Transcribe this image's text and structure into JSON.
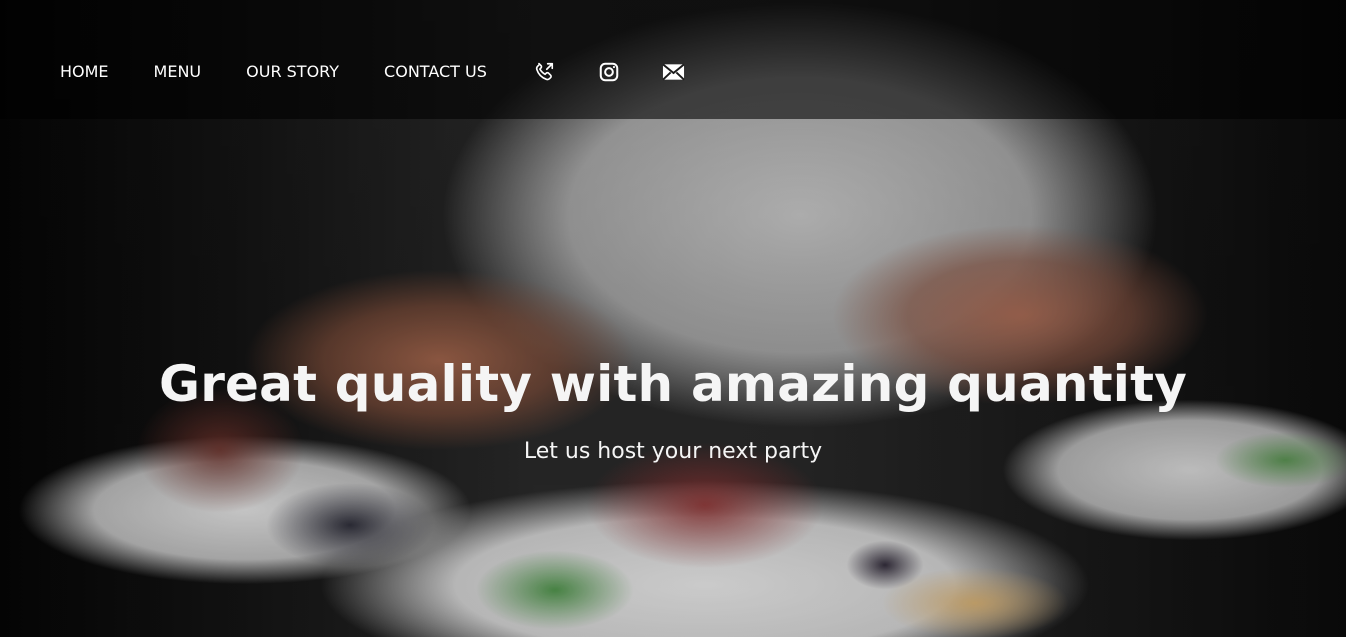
{
  "nav": {
    "home": "HOME",
    "menu": "MENU",
    "story": "OUR STORY",
    "contact": "CONTACT US"
  },
  "icons": {
    "phone": "phone-icon",
    "instagram": "instagram-icon",
    "email": "email-icon"
  },
  "hero": {
    "title": "Great quality with amazing quantity",
    "subtitle": "Let us host your next party"
  },
  "colors": {
    "text": "#ffffff",
    "overlay": "rgba(0,0,0,0.58)"
  }
}
